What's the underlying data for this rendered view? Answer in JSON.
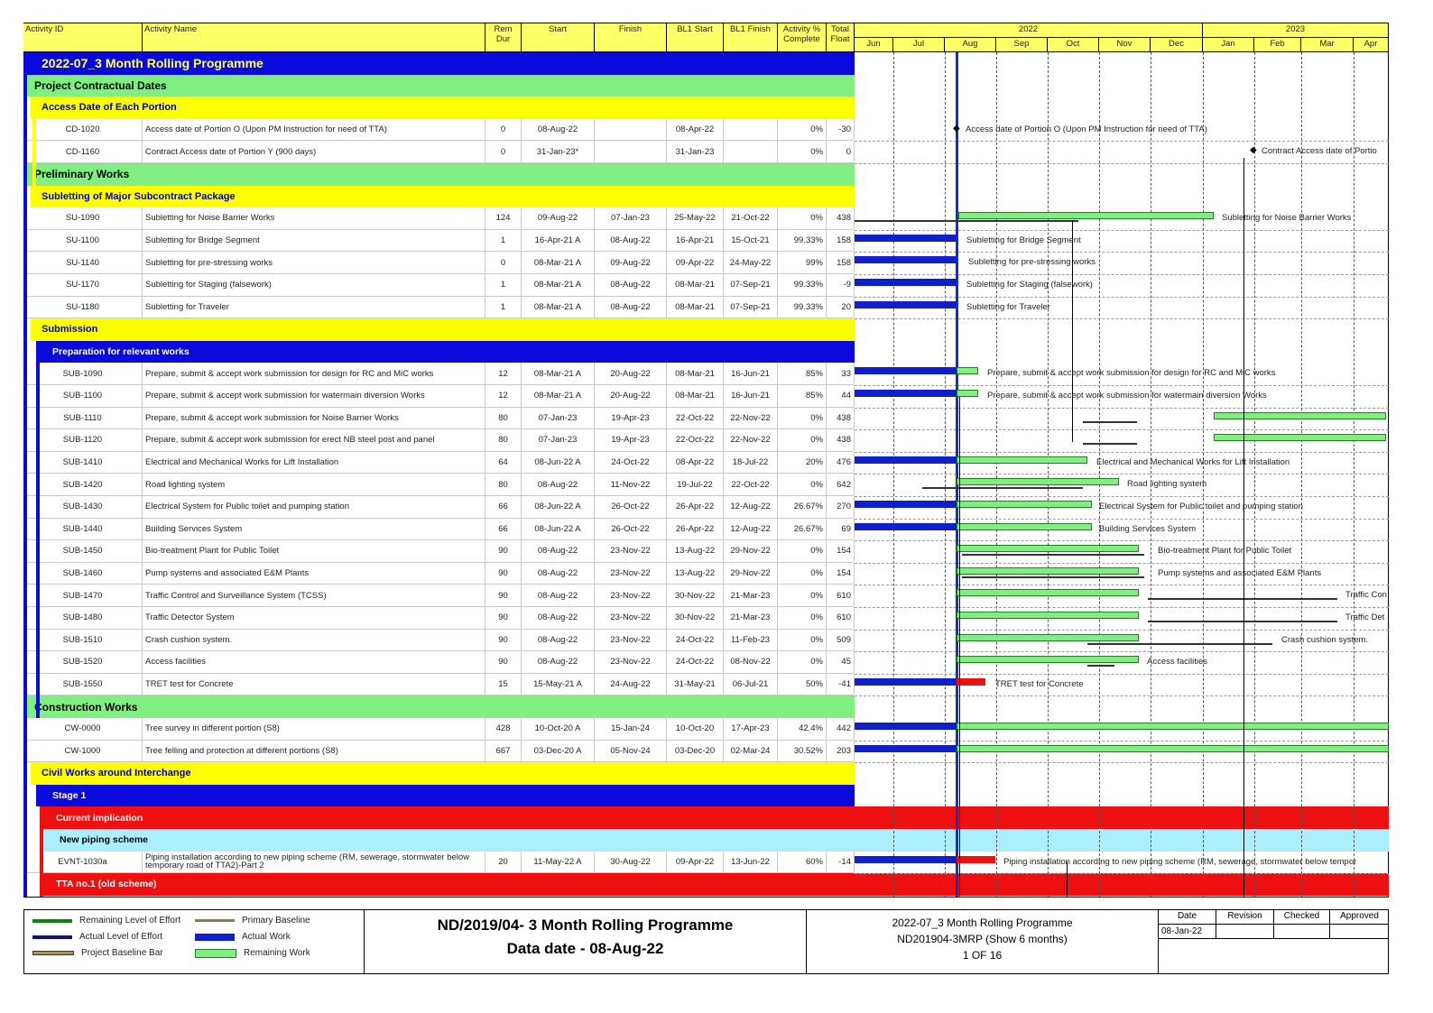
{
  "columns": {
    "activity_id": "Activity ID",
    "activity_name": "Activity Name",
    "rem_dur": "Rem Dur",
    "start": "Start",
    "finish": "Finish",
    "bl1_start": "BL1 Start",
    "bl1_finish": "BL1 Finish",
    "pct": "Activity % Complete",
    "float": "Total Float"
  },
  "timeline": {
    "years": [
      {
        "label": "2022"
      },
      {
        "label": "2023"
      }
    ],
    "months": [
      "Jun",
      "Jul",
      "Aug",
      "Sep",
      "Oct",
      "Nov",
      "Dec",
      "Jan",
      "Feb",
      "Mar",
      "Apr"
    ]
  },
  "rows": [
    {
      "type": "band",
      "level": 0,
      "text": "2022-07_3 Month Rolling Programme"
    },
    {
      "type": "band",
      "level": 1,
      "text": "Project Contractual Dates"
    },
    {
      "type": "band",
      "level": 2,
      "text": "Access Date of Each Portion"
    },
    {
      "type": "data",
      "id": "CD-1020",
      "name": "Access date of Portion O (Upon PM Instruction for need of TTA)",
      "rem": "0",
      "start": "08-Aug-22",
      "finish": "",
      "bl_start": "08-Apr-22",
      "bl_finish": "",
      "pct": "0%",
      "float": "-30",
      "gantt": "Access date of Portion O (Upon PM Instruction for need of TTA)"
    },
    {
      "type": "data",
      "id": "CD-1160",
      "name": "Contract Access date of Portion Y (900 days)",
      "rem": "0",
      "start": "31-Jan-23*",
      "finish": "",
      "bl_start": "31-Jan-23",
      "bl_finish": "",
      "pct": "0%",
      "float": "0",
      "gantt": "Contract Access date of Portio"
    },
    {
      "type": "band",
      "level": 1,
      "text": "Preliminary Works"
    },
    {
      "type": "band",
      "level": 2,
      "text": "Subletting of Major Subcontract Package"
    },
    {
      "type": "data",
      "id": "SU-1090",
      "name": "Subletting for Noise Barrier Works",
      "rem": "124",
      "start": "09-Aug-22",
      "finish": "07-Jan-23",
      "bl_start": "25-May-22",
      "bl_finish": "21-Oct-22",
      "pct": "0%",
      "float": "438",
      "gantt": "Subletting for Noise Barrier Works"
    },
    {
      "type": "data",
      "id": "SU-1100",
      "name": "Subletting for Bridge Segment",
      "rem": "1",
      "start": "16-Apr-21 A",
      "finish": "08-Aug-22",
      "bl_start": "16-Apr-21",
      "bl_finish": "15-Oct-21",
      "pct": "99.33%",
      "float": "158",
      "gantt": "Subletting for Bridge Segment"
    },
    {
      "type": "data",
      "id": "SU-1140",
      "name": "Subletting for pre-stressing works",
      "rem": "0",
      "start": "08-Mar-21 A",
      "finish": "09-Aug-22",
      "bl_start": "09-Apr-22",
      "bl_finish": "24-May-22",
      "pct": "99%",
      "float": "158",
      "gantt": "Subletting for pre-stressing works"
    },
    {
      "type": "data",
      "id": "SU-1170",
      "name": "Subletting for Staging (falsework)",
      "rem": "1",
      "start": "08-Mar-21 A",
      "finish": "08-Aug-22",
      "bl_start": "08-Mar-21",
      "bl_finish": "07-Sep-21",
      "pct": "99.33%",
      "float": "-9",
      "gantt": "Subletting for Staging (falsework)"
    },
    {
      "type": "data",
      "id": "SU-1180",
      "name": "Subletting for Traveler",
      "rem": "1",
      "start": "08-Mar-21 A",
      "finish": "08-Aug-22",
      "bl_start": "08-Mar-21",
      "bl_finish": "07-Sep-21",
      "pct": "99.33%",
      "float": "20",
      "gantt": "Subletting for Traveler"
    },
    {
      "type": "band",
      "level": 2,
      "text": "Submission"
    },
    {
      "type": "band",
      "level": 3,
      "text": "Preparation for relevant works"
    },
    {
      "type": "data",
      "id": "SUB-1090",
      "name": "Prepare, submit & accept work submission for design for RC and MiC works",
      "rem": "12",
      "start": "08-Mar-21 A",
      "finish": "20-Aug-22",
      "bl_start": "08-Mar-21",
      "bl_finish": "16-Jun-21",
      "pct": "85%",
      "float": "33",
      "gantt": "Prepare, submit & accept work submission for design for RC and MiC works"
    },
    {
      "type": "data",
      "id": "SUB-1100",
      "name": "Prepare, submit & accept work submission for watermain diversion Works",
      "rem": "12",
      "start": "08-Mar-21 A",
      "finish": "20-Aug-22",
      "bl_start": "08-Mar-21",
      "bl_finish": "16-Jun-21",
      "pct": "85%",
      "float": "44",
      "gantt": "Prepare, submit & accept work submission for watermain diversion Works"
    },
    {
      "type": "data",
      "id": "SUB-1110",
      "name": "Prepare, submit & accept work submission for Noise Barrier Works",
      "rem": "80",
      "start": "07-Jan-23",
      "finish": "19-Apr-23",
      "bl_start": "22-Oct-22",
      "bl_finish": "22-Nov-22",
      "pct": "0%",
      "float": "438",
      "gantt": ""
    },
    {
      "type": "data",
      "id": "SUB-1120",
      "name": "Prepare, submit & accept work submission for erect NB steel post and panel",
      "rem": "80",
      "start": "07-Jan-23",
      "finish": "19-Apr-23",
      "bl_start": "22-Oct-22",
      "bl_finish": "22-Nov-22",
      "pct": "0%",
      "float": "438",
      "gantt": ""
    },
    {
      "type": "data",
      "id": "SUB-1410",
      "name": "Electrical and Mechanical Works for Lift Installation",
      "rem": "64",
      "start": "08-Jun-22 A",
      "finish": "24-Oct-22",
      "bl_start": "08-Apr-22",
      "bl_finish": "18-Jul-22",
      "pct": "20%",
      "float": "476",
      "gantt": "Electrical and Mechanical Works for Lift Installation"
    },
    {
      "type": "data",
      "id": "SUB-1420",
      "name": "Road lighting system",
      "rem": "80",
      "start": "08-Aug-22",
      "finish": "11-Nov-22",
      "bl_start": "19-Jul-22",
      "bl_finish": "22-Oct-22",
      "pct": "0%",
      "float": "642",
      "gantt": "Road lighting system"
    },
    {
      "type": "data",
      "id": "SUB-1430",
      "name": "Electrical System for Public toilet and pumping station",
      "rem": "66",
      "start": "08-Jun-22 A",
      "finish": "26-Oct-22",
      "bl_start": "26-Apr-22",
      "bl_finish": "12-Aug-22",
      "pct": "26.67%",
      "float": "270",
      "gantt": "Electrical System for Public toilet and pumping station"
    },
    {
      "type": "data",
      "id": "SUB-1440",
      "name": "Building Services System",
      "rem": "66",
      "start": "08-Jun-22 A",
      "finish": "26-Oct-22",
      "bl_start": "26-Apr-22",
      "bl_finish": "12-Aug-22",
      "pct": "26.67%",
      "float": "69",
      "gantt": "Building Services System"
    },
    {
      "type": "data",
      "id": "SUB-1450",
      "name": "Bio-treatment Plant for Public Toilet",
      "rem": "90",
      "start": "08-Aug-22",
      "finish": "23-Nov-22",
      "bl_start": "13-Aug-22",
      "bl_finish": "29-Nov-22",
      "pct": "0%",
      "float": "154",
      "gantt": "Bio-treatment Plant for Public Toilet"
    },
    {
      "type": "data",
      "id": "SUB-1460",
      "name": "Pump systems and associated E&M Plants",
      "rem": "90",
      "start": "08-Aug-22",
      "finish": "23-Nov-22",
      "bl_start": "13-Aug-22",
      "bl_finish": "29-Nov-22",
      "pct": "0%",
      "float": "154",
      "gantt": "Pump systems and associated E&M Plants"
    },
    {
      "type": "data",
      "id": "SUB-1470",
      "name": "Traffic Control and Surveillance System (TCSS)",
      "rem": "90",
      "start": "08-Aug-22",
      "finish": "23-Nov-22",
      "bl_start": "30-Nov-22",
      "bl_finish": "21-Mar-23",
      "pct": "0%",
      "float": "610",
      "gantt": "Traffic Con"
    },
    {
      "type": "data",
      "id": "SUB-1480",
      "name": "Traffic Detector System",
      "rem": "90",
      "start": "08-Aug-22",
      "finish": "23-Nov-22",
      "bl_start": "30-Nov-22",
      "bl_finish": "21-Mar-23",
      "pct": "0%",
      "float": "610",
      "gantt": "Traffic Det"
    },
    {
      "type": "data",
      "id": "SUB-1510",
      "name": "Crash cushion system.",
      "rem": "90",
      "start": "08-Aug-22",
      "finish": "23-Nov-22",
      "bl_start": "24-Oct-22",
      "bl_finish": "11-Feb-23",
      "pct": "0%",
      "float": "509",
      "gantt": "Crash cushion system."
    },
    {
      "type": "data",
      "id": "SUB-1520",
      "name": "Access facilities",
      "rem": "90",
      "start": "08-Aug-22",
      "finish": "23-Nov-22",
      "bl_start": "24-Oct-22",
      "bl_finish": "08-Nov-22",
      "pct": "0%",
      "float": "45",
      "gantt": "Access facilities"
    },
    {
      "type": "data",
      "id": "SUB-1550",
      "name": "TRET test for Concrete",
      "rem": "15",
      "start": "15-May-21 A",
      "finish": "24-Aug-22",
      "bl_start": "31-May-21",
      "bl_finish": "06-Jul-21",
      "pct": "50%",
      "float": "-41",
      "gantt": "TRET test for Concrete"
    },
    {
      "type": "band",
      "level": 1,
      "text": "Construction Works"
    },
    {
      "type": "data",
      "id": "CW-0000",
      "name": "Tree survey in different portion (S8)",
      "rem": "428",
      "start": "10-Oct-20 A",
      "finish": "15-Jan-24",
      "bl_start": "10-Oct-20",
      "bl_finish": "17-Apr-23",
      "pct": "42.4%",
      "float": "442",
      "gantt": ""
    },
    {
      "type": "data",
      "id": "CW-1000",
      "name": "Tree felling and protection at different portions (S8)",
      "rem": "667",
      "start": "03-Dec-20 A",
      "finish": "05-Nov-24",
      "bl_start": "03-Dec-20",
      "bl_finish": "02-Mar-24",
      "pct": "30.52%",
      "float": "203",
      "gantt": ""
    },
    {
      "type": "band",
      "level": 2,
      "text": "Civil Works around Interchange"
    },
    {
      "type": "band",
      "level": 3,
      "text": "Stage 1"
    },
    {
      "type": "band",
      "level": 4,
      "text": "Current implication"
    },
    {
      "type": "band",
      "level": 5,
      "text": "New piping scheme"
    },
    {
      "type": "data",
      "id": "EVNT-1030a",
      "name": "Piping installation according to new piping scheme (RM, sewerage, stormwater below temporary road of TTA2)-Part 2",
      "rem": "20",
      "start": "11-May-22 A",
      "finish": "30-Aug-22",
      "bl_start": "09-Apr-22",
      "bl_finish": "13-Jun-22",
      "pct": "60%",
      "float": "-14",
      "gantt": "Piping installation according to new piping scheme (RM, sewerage, stormwater below tempor"
    },
    {
      "type": "band",
      "level": 4,
      "text": "TTA no.1 (old scheme)"
    }
  ],
  "legend": [
    {
      "label": "Remaining Level of Effort",
      "color": "#108010"
    },
    {
      "label": "Actual Level of Effort",
      "color": "#101080"
    },
    {
      "label": "Project Baseline Bar",
      "color": "#b89830"
    },
    {
      "label": "Primary Baseline",
      "color": "#8a7a50"
    },
    {
      "label": "Actual Work",
      "color": "#1020c8"
    },
    {
      "label": "Remaining Work",
      "color": "#80ee80"
    }
  ],
  "footer": {
    "title_line1": "ND/2019/04-  3 Month Rolling Programme",
    "title_line2": "Data date - 08-Aug-22",
    "info_line1": "2022-07_3 Month Rolling Programme",
    "info_line2": "ND201904-3MRP (Show 6 months)",
    "info_line3": "1 OF 16",
    "rev_headers": [
      "Date",
      "Revision",
      "Checked",
      "Approved"
    ],
    "rev_date": "08-Jan-22"
  },
  "colors": {
    "yellow": "#ffff00",
    "green": "#80ee80",
    "blue": "#0a0adc",
    "red": "#ee1010",
    "cyan": "#aaeeff"
  }
}
